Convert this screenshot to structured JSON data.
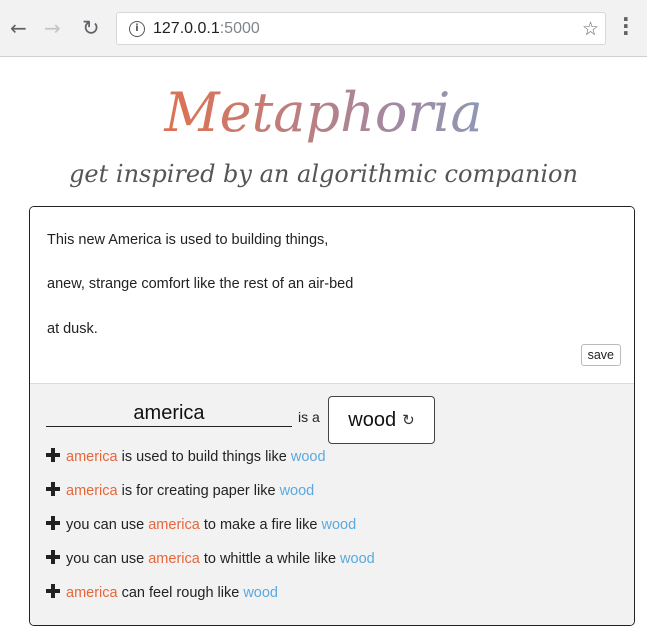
{
  "browser": {
    "url_host": "127.0.0.1",
    "url_port": ":5000",
    "icons": {
      "back": "back-arrow-icon",
      "forward": "forward-arrow-icon",
      "reload": "reload-icon",
      "info": "info-icon",
      "bookmark": "star-icon",
      "menu": "more-vert-icon"
    }
  },
  "app": {
    "title": "Metaphoria",
    "subtitle": "get inspired by an algorithmic companion",
    "colors": {
      "subject": "#e8663a",
      "vehicle": "#5aa9df"
    }
  },
  "poem": {
    "lines": [
      "This new America is used to building things,",
      "anew, strange comfort like the rest of an air-bed",
      "at dusk."
    ],
    "save_label": "save"
  },
  "metaphor_builder": {
    "subject": "america",
    "connector": "is a",
    "vehicle": "wood",
    "suggestions": [
      {
        "before": "",
        "subject": "america",
        "middle": " is used to build things like ",
        "vehicle": "wood"
      },
      {
        "before": "",
        "subject": "america",
        "middle": " is for creating paper like ",
        "vehicle": "wood"
      },
      {
        "before": "you can use ",
        "subject": "america",
        "middle": " to make a fire like ",
        "vehicle": "wood"
      },
      {
        "before": "you can use ",
        "subject": "america",
        "middle": " to whittle a while like ",
        "vehicle": "wood"
      },
      {
        "before": "",
        "subject": "america",
        "middle": " can feel rough like ",
        "vehicle": "wood"
      }
    ]
  }
}
